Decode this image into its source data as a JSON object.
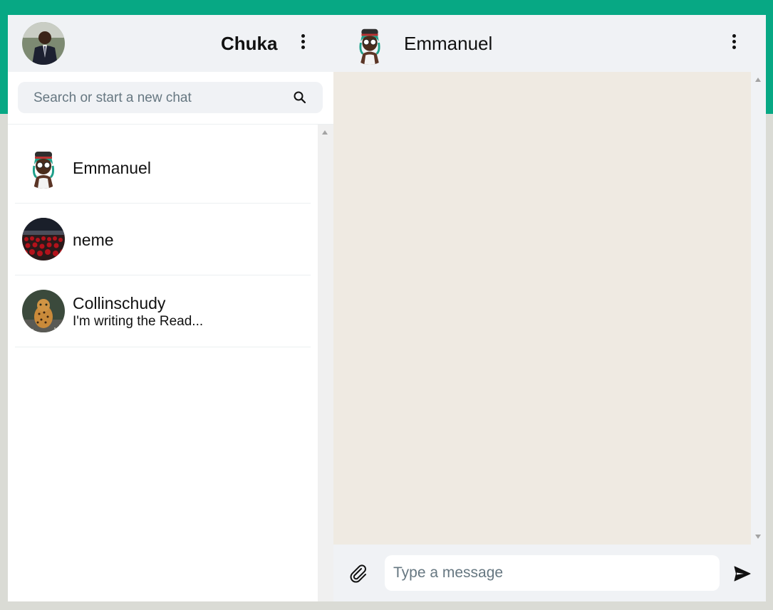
{
  "colors": {
    "brand_band": "#07a884",
    "panel_bg": "#f0f2f5",
    "chat_bg": "#efeae2"
  },
  "user": {
    "name": "Chuka",
    "avatar": "user-photo"
  },
  "search": {
    "placeholder": "Search or start a new chat"
  },
  "chats": [
    {
      "name": "Emmanuel",
      "preview": "",
      "avatar": "cartoon-avatar"
    },
    {
      "name": "neme",
      "preview": "",
      "avatar": "crowd-avatar"
    },
    {
      "name": "Collinschudy",
      "preview": "I'm writing the Read...",
      "avatar": "leopard-avatar"
    }
  ],
  "active_chat": {
    "name": "Emmanuel",
    "avatar": "cartoon-avatar"
  },
  "composer": {
    "placeholder": "Type a message"
  },
  "icons": {
    "menu": "kebab-menu-icon",
    "search": "search-icon",
    "attach": "paperclip-icon",
    "send": "send-icon"
  }
}
